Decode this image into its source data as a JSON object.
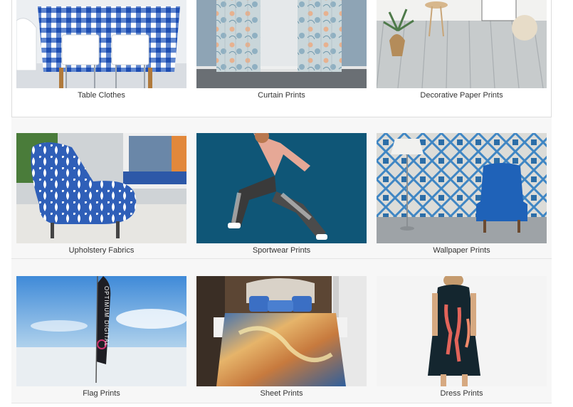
{
  "gallery": {
    "items": [
      {
        "label": "Table Clothes",
        "image": "blue-gingham-tablecloth-image"
      },
      {
        "label": "Curtain Prints",
        "image": "floral-curtains-image"
      },
      {
        "label": "Decorative Paper Prints",
        "image": "wood-floor-room-image"
      },
      {
        "label": "Upholstery Fabrics",
        "image": "blue-pattern-armchair-image"
      },
      {
        "label": "Sportwear Prints",
        "image": "runner-leggings-image"
      },
      {
        "label": "Wallpaper Prints",
        "image": "tile-wallpaper-blue-chair-image"
      },
      {
        "label": "Flag Prints",
        "image": "feather-flag-sky-image"
      },
      {
        "label": "Sheet Prints",
        "image": "printed-bedsheet-image"
      },
      {
        "label": "Dress Prints",
        "image": "flamingo-dress-image"
      }
    ],
    "flag_text": "OPTIMUM DIGITAL"
  }
}
